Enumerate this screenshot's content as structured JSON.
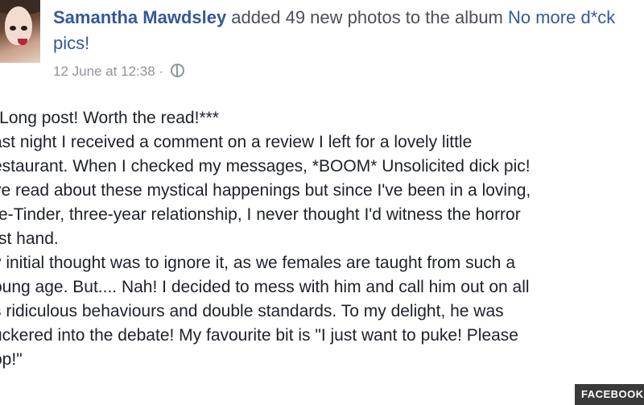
{
  "post": {
    "author": "Samantha Mawdsley",
    "action_text": " added 49 new photos to the album ",
    "album_name": "No more d*ck pics!",
    "timestamp": "12 June at 12:38",
    "separator": " · ",
    "privacy_icon": "globe-icon",
    "body_lines": [
      "*Long post! Worth the read!***",
      "ast night I received a comment on a review I left for a lovely little",
      "estaurant. When I checked my messages, *BOOM* Unsolicited dick pic!",
      "ve read about these mystical happenings but since I've been in a loving,",
      "re-Tinder, three-year relationship, I never thought I'd witness the horror",
      "rst hand.",
      "y initial thought was to ignore it, as we females are taught from such a",
      "oung age. But.... Nah! I decided to mess with him and call him out on all",
      "s ridiculous behaviours and double standards. To my delight, he was",
      "uckered into the debate! My favourite bit is \"I just want to puke! Please",
      "op!\""
    ]
  },
  "watermark": "FACEBOOK",
  "colors": {
    "link_blue": "#365899",
    "meta_grey": "#90949c",
    "text": "#1d2129"
  }
}
